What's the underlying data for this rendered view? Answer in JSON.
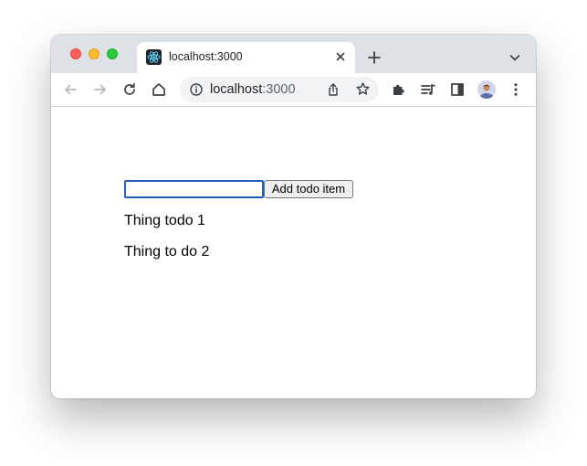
{
  "tab": {
    "title": "localhost:3000",
    "favicon": "react-icon"
  },
  "toolbar": {
    "url_host": "localhost",
    "url_port": ":3000",
    "icons": [
      "back-arrow-icon",
      "forward-arrow-icon",
      "reload-icon",
      "home-icon",
      "site-info-icon",
      "share-icon",
      "star-icon",
      "extensions-icon",
      "media-control-icon",
      "side-panel-icon",
      "profile-avatar",
      "menu-kebab-icon"
    ]
  },
  "page": {
    "input": {
      "value": "",
      "placeholder": ""
    },
    "add_button_label": "Add todo item",
    "todos": [
      "Thing todo 1",
      "Thing to do 2"
    ]
  },
  "colors": {
    "traffic_red": "#fe5f57",
    "traffic_yellow": "#febc2e",
    "traffic_green": "#28c840",
    "input_focus_border": "#1f5fbf",
    "tabstrip_bg": "#dee1e6",
    "react_blue": "#61dafb"
  }
}
